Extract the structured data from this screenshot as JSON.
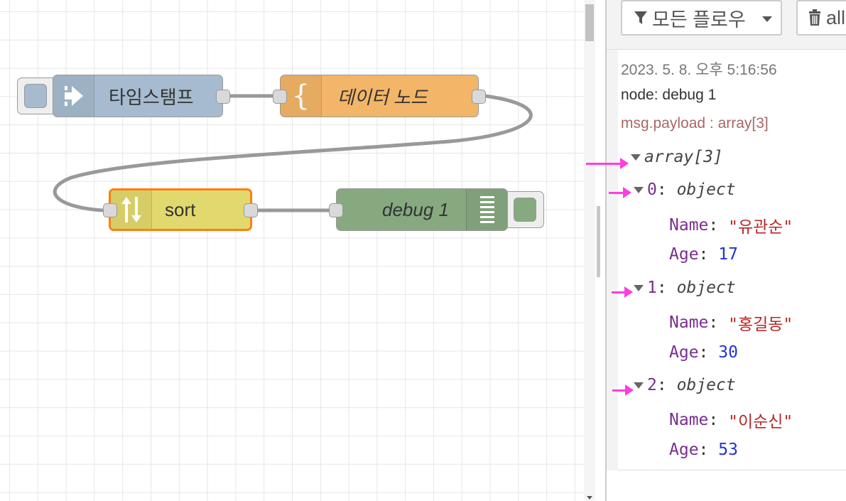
{
  "workspace": {
    "nodes": {
      "inject": {
        "label": "타임스탬프",
        "color": "#a6bbcf"
      },
      "change": {
        "label": "데이터 노드",
        "color": "#f3b567"
      },
      "sort": {
        "label": "sort",
        "color": "#e2d96e",
        "selected_border": "#ff7f0e"
      },
      "debug": {
        "label": "debug 1",
        "color": "#87a980"
      }
    }
  },
  "sidebar": {
    "filter_label": "모든 플로우",
    "clear_label": "all",
    "message": {
      "timestamp": "2023. 5. 8. 오후 5:16:56",
      "node": "node: debug 1",
      "topic": "msg.payload : array[3]",
      "root_type": "array[3]",
      "items": [
        {
          "index": "0",
          "type": "object",
          "name_key": "Name",
          "name_val": "\"유관순\"",
          "age_key": "Age",
          "age_val": "17"
        },
        {
          "index": "1",
          "type": "object",
          "name_key": "Name",
          "name_val": "\"홍길동\"",
          "age_key": "Age",
          "age_val": "30"
        },
        {
          "index": "2",
          "type": "object",
          "name_key": "Name",
          "name_val": "\"이순신\"",
          "age_key": "Age",
          "age_val": "53"
        }
      ]
    }
  },
  "annotation_color": "#ff3de0"
}
